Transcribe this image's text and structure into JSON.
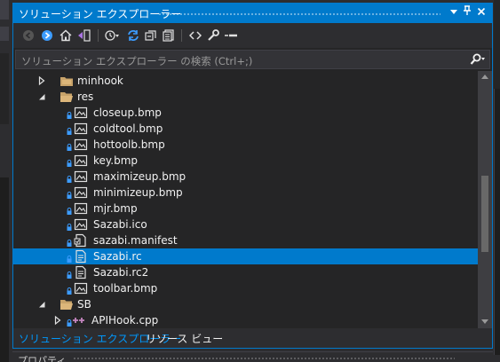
{
  "window": {
    "title": "ソリューション エクスプローラー",
    "dropdown_icon": "dropdown-arrow-icon",
    "pin_icon": "pin-icon",
    "close_icon": "close-icon"
  },
  "search": {
    "placeholder": "ソリューション エクスプローラー の検索 (Ctrl+;)"
  },
  "tree": {
    "items": [
      {
        "label": "minhook",
        "type": "filter",
        "expander": "collapsed"
      },
      {
        "label": "res",
        "type": "filter-open",
        "expander": "expanded"
      },
      {
        "label": "closeup.bmp",
        "type": "image",
        "locked": true
      },
      {
        "label": "coldtool.bmp",
        "type": "image",
        "locked": true
      },
      {
        "label": "hottoolb.bmp",
        "type": "image",
        "locked": true
      },
      {
        "label": "key.bmp",
        "type": "image",
        "locked": true
      },
      {
        "label": "maximizeup.bmp",
        "type": "image",
        "locked": true
      },
      {
        "label": "minimizeup.bmp",
        "type": "image",
        "locked": true
      },
      {
        "label": "mjr.bmp",
        "type": "image",
        "locked": true
      },
      {
        "label": "Sazabi.ico",
        "type": "image",
        "locked": true
      },
      {
        "label": "sazabi.manifest",
        "type": "manifest",
        "locked": true
      },
      {
        "label": "Sazabi.rc",
        "type": "resource",
        "locked": true,
        "selected": true
      },
      {
        "label": "Sazabi.rc2",
        "type": "resource",
        "locked": true
      },
      {
        "label": "toolbar.bmp",
        "type": "image",
        "locked": true
      },
      {
        "label": "SB",
        "type": "filter-open",
        "expander": "expanded"
      },
      {
        "label": "APIHook.cpp",
        "type": "cpp",
        "locked": true,
        "expander": "collapsed"
      }
    ]
  },
  "tabs": [
    {
      "label": "ソリューション エクスプローラー",
      "active": true
    },
    {
      "label": "リソース ビュー",
      "active": false
    }
  ],
  "bottom_panel": {
    "title": "プロパティ"
  },
  "colors": {
    "accent": "#007acc",
    "background": "#252526",
    "toolbar": "#2d2d30",
    "text": "#f1f1f1",
    "active_tab": "#0097fb",
    "lock": "#3c9cff",
    "folder": "#dcb67a"
  }
}
